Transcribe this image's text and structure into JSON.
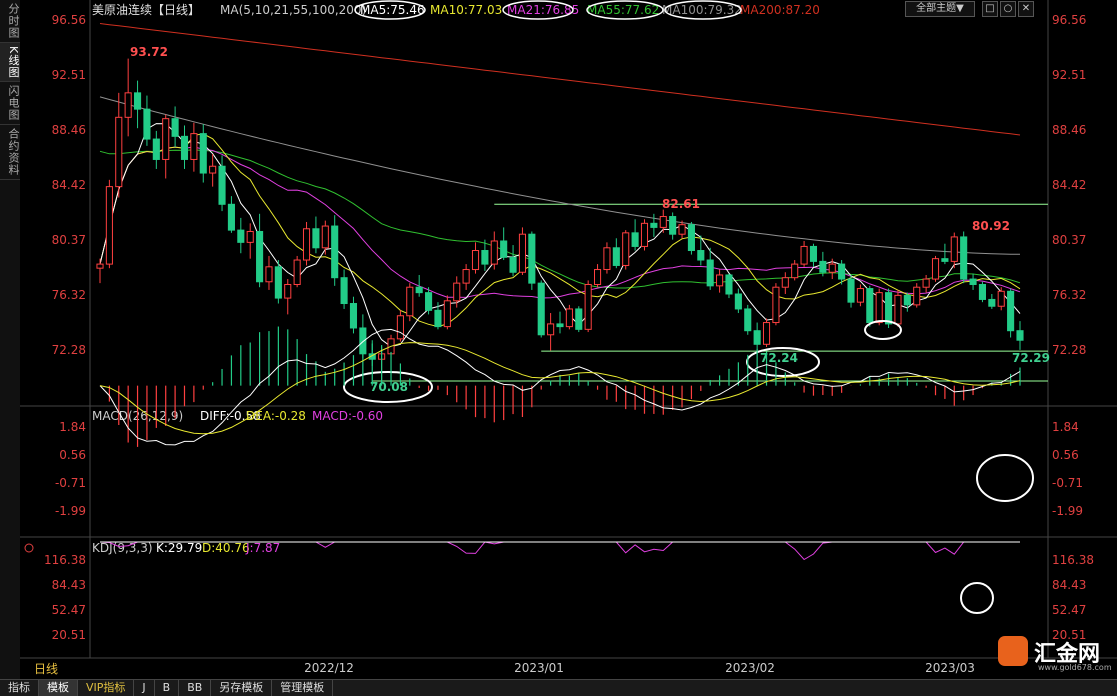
{
  "sidebar": {
    "tabs": [
      "分时图",
      "K线图",
      "闪电图",
      "合约资料"
    ],
    "active": 1
  },
  "header": {
    "title": "美原油连续【日线】",
    "ma_label": "MA(5,10,21,55,100,200)",
    "ma_values": [
      "MA5:75.46",
      "MA10:77.03",
      "MA21:76.85",
      "MA55:77.62",
      "MA100:79.32",
      "MA200:87.20"
    ],
    "theme_button": "全部主题▼",
    "window_buttons": [
      "□",
      "○",
      "✕"
    ]
  },
  "colors": {
    "up": "#ff4040",
    "down": "#22cc88",
    "ma5": "#ffffff",
    "ma10": "#e8e830",
    "ma21": "#e040e0",
    "ma55": "#30c030",
    "ma100": "#909090",
    "ma200": "#d03020"
  },
  "price_axis": {
    "ticks": [
      "96.56",
      "92.51",
      "88.46",
      "84.42",
      "80.37",
      "76.32",
      "72.28"
    ]
  },
  "annotations": {
    "high": "93.72",
    "mid_high": "82.61",
    "right_high": "80.92",
    "low1": "70.08",
    "low2": "72.24",
    "low3": "72.29"
  },
  "macd": {
    "label": "MACD(26,12,9)",
    "diff": "DIFF:-0.58",
    "dea": "DEA:-0.28",
    "macd": "MACD:-0.60",
    "ticks": [
      "1.84",
      "0.56",
      "-0.71",
      "-1.99"
    ]
  },
  "kdj": {
    "label": "KDJ(9,3,3)",
    "k": "K:29.79",
    "d": "D:40.76",
    "j": "J:7.87",
    "ticks": [
      "116.38",
      "84.43",
      "52.47",
      "20.51"
    ]
  },
  "date_axis": {
    "labels": [
      "2022/12",
      "2023/01",
      "2023/02",
      "2023/03"
    ],
    "left_label": "日线"
  },
  "bottom_tabs": [
    "指标",
    "模板",
    "VIP指标",
    "J",
    "B",
    "BB",
    "另存模板",
    "管理模板"
  ],
  "logo": {
    "text": "汇金网",
    "url": "www.gold678.com"
  },
  "chart_data": {
    "type": "candlestick",
    "title": "美原油连续【日线】",
    "ylim": [
      70.0,
      97.0
    ],
    "x_labels": [
      "2022/12",
      "2023/01",
      "2023/02",
      "2023/03"
    ],
    "candles": [
      [
        78.3,
        79.0,
        77.2,
        78.6
      ],
      [
        78.6,
        84.8,
        78.3,
        84.3
      ],
      [
        84.3,
        91.2,
        83.5,
        89.4
      ],
      [
        89.4,
        93.72,
        88.0,
        91.2
      ],
      [
        91.2,
        92.1,
        88.6,
        90.0
      ],
      [
        90.0,
        91.0,
        87.3,
        87.8
      ],
      [
        87.8,
        88.4,
        85.6,
        86.3
      ],
      [
        86.3,
        89.6,
        84.9,
        89.3
      ],
      [
        89.3,
        90.2,
        87.2,
        88.0
      ],
      [
        88.0,
        88.8,
        85.6,
        86.3
      ],
      [
        86.3,
        89.0,
        85.4,
        88.2
      ],
      [
        88.2,
        88.9,
        84.6,
        85.3
      ],
      [
        85.3,
        86.7,
        84.3,
        85.8
      ],
      [
        85.8,
        86.6,
        82.5,
        83.0
      ],
      [
        83.0,
        83.6,
        80.9,
        81.1
      ],
      [
        81.1,
        82.0,
        79.4,
        80.2
      ],
      [
        80.2,
        81.6,
        79.0,
        81.0
      ],
      [
        81.0,
        82.3,
        76.9,
        77.3
      ],
      [
        77.3,
        79.2,
        76.7,
        78.4
      ],
      [
        78.4,
        78.9,
        75.7,
        76.1
      ],
      [
        76.1,
        77.5,
        74.9,
        77.1
      ],
      [
        77.1,
        79.2,
        76.9,
        78.9
      ],
      [
        78.9,
        81.7,
        78.5,
        81.2
      ],
      [
        81.2,
        82.1,
        79.4,
        79.8
      ],
      [
        79.8,
        81.8,
        79.3,
        81.4
      ],
      [
        81.4,
        82.2,
        77.0,
        77.6
      ],
      [
        77.6,
        78.2,
        75.3,
        75.7
      ],
      [
        75.7,
        76.2,
        73.5,
        73.9
      ],
      [
        73.9,
        74.9,
        71.7,
        72.0
      ],
      [
        72.0,
        73.0,
        71.1,
        71.6
      ],
      [
        71.6,
        72.5,
        70.08,
        72.0
      ],
      [
        72.0,
        73.4,
        71.6,
        73.1
      ],
      [
        73.1,
        75.2,
        72.9,
        74.8
      ],
      [
        74.8,
        77.2,
        74.4,
        76.9
      ],
      [
        76.9,
        77.8,
        76.2,
        76.5
      ],
      [
        76.5,
        76.9,
        74.9,
        75.2
      ],
      [
        75.2,
        75.8,
        73.8,
        74.0
      ],
      [
        74.0,
        76.3,
        73.8,
        75.9
      ],
      [
        75.9,
        77.7,
        75.4,
        77.2
      ],
      [
        77.2,
        78.6,
        76.7,
        78.2
      ],
      [
        78.2,
        80.2,
        77.9,
        79.6
      ],
      [
        79.6,
        80.4,
        78.1,
        78.6
      ],
      [
        78.6,
        81.0,
        78.2,
        80.3
      ],
      [
        80.3,
        81.3,
        78.9,
        79.1
      ],
      [
        79.1,
        80.0,
        77.7,
        78.0
      ],
      [
        78.0,
        81.3,
        77.8,
        80.8
      ],
      [
        80.8,
        81.0,
        76.7,
        77.2
      ],
      [
        77.2,
        77.4,
        73.2,
        73.4
      ],
      [
        73.4,
        75.0,
        72.24,
        74.2
      ],
      [
        74.2,
        75.1,
        73.5,
        74.0
      ],
      [
        74.0,
        75.6,
        73.8,
        75.3
      ],
      [
        75.3,
        75.5,
        73.6,
        73.8
      ],
      [
        73.8,
        77.4,
        73.6,
        77.1
      ],
      [
        77.1,
        78.6,
        76.9,
        78.2
      ],
      [
        78.2,
        80.2,
        77.9,
        79.8
      ],
      [
        79.8,
        80.5,
        78.3,
        78.5
      ],
      [
        78.5,
        81.1,
        78.2,
        80.9
      ],
      [
        80.9,
        81.9,
        79.6,
        79.9
      ],
      [
        79.9,
        81.9,
        79.6,
        81.6
      ],
      [
        81.6,
        82.3,
        80.6,
        81.3
      ],
      [
        81.3,
        82.61,
        80.9,
        82.1
      ],
      [
        82.1,
        82.4,
        80.4,
        80.8
      ],
      [
        80.8,
        81.8,
        80.5,
        81.5
      ],
      [
        81.5,
        81.7,
        79.3,
        79.6
      ],
      [
        79.6,
        80.7,
        78.5,
        78.9
      ],
      [
        78.9,
        79.8,
        76.7,
        77.0
      ],
      [
        77.0,
        78.2,
        76.5,
        77.8
      ],
      [
        77.8,
        77.9,
        76.1,
        76.4
      ],
      [
        76.4,
        76.8,
        75.0,
        75.3
      ],
      [
        75.3,
        75.6,
        73.4,
        73.7
      ],
      [
        73.7,
        74.3,
        72.24,
        72.7
      ],
      [
        72.7,
        74.6,
        72.5,
        74.3
      ],
      [
        74.3,
        77.2,
        74.1,
        76.9
      ],
      [
        76.9,
        78.0,
        76.4,
        77.6
      ],
      [
        77.6,
        78.9,
        77.4,
        78.6
      ],
      [
        78.6,
        80.3,
        78.4,
        79.9
      ],
      [
        79.9,
        80.1,
        78.4,
        78.8
      ],
      [
        78.8,
        79.5,
        77.7,
        78.0
      ],
      [
        78.0,
        79.0,
        77.5,
        78.6
      ],
      [
        78.6,
        78.9,
        77.1,
        77.5
      ],
      [
        77.5,
        77.8,
        75.4,
        75.8
      ],
      [
        75.8,
        77.1,
        75.5,
        76.8
      ],
      [
        76.8,
        77.0,
        74.0,
        74.3
      ],
      [
        74.3,
        76.8,
        74.1,
        76.5
      ],
      [
        76.5,
        76.8,
        73.9,
        74.2
      ],
      [
        74.2,
        76.7,
        74.0,
        76.3
      ],
      [
        76.3,
        76.5,
        75.1,
        75.6
      ],
      [
        75.6,
        77.2,
        75.4,
        76.9
      ],
      [
        76.9,
        77.8,
        76.5,
        77.5
      ],
      [
        77.5,
        79.2,
        77.3,
        79.0
      ],
      [
        79.0,
        80.1,
        78.6,
        78.8
      ],
      [
        78.8,
        80.92,
        78.3,
        80.6
      ],
      [
        80.6,
        81.0,
        77.2,
        77.5
      ],
      [
        77.5,
        77.9,
        76.7,
        77.1
      ],
      [
        77.1,
        77.3,
        75.8,
        76.0
      ],
      [
        76.0,
        76.4,
        75.3,
        75.5
      ],
      [
        75.5,
        76.9,
        75.2,
        76.6
      ],
      [
        76.6,
        76.8,
        73.2,
        73.7
      ],
      [
        73.7,
        74.4,
        72.29,
        73.0
      ]
    ],
    "series": [
      {
        "name": "MA200",
        "values": [
          96.3,
          88.1
        ]
      },
      {
        "name": "MA100",
        "values": [
          90.9,
          79.32
        ]
      },
      {
        "name": "MA55",
        "values": [
          86.9,
          77.62
        ]
      }
    ],
    "macd_range": [
      -2.6,
      2.0
    ],
    "kdj_range": [
      0,
      125
    ]
  }
}
